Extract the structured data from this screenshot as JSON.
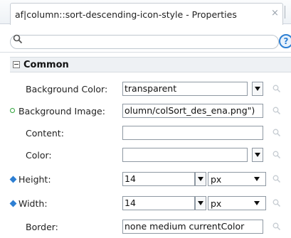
{
  "window": {
    "tab_title": "af|column::sort-descending-icon-style - Properties",
    "close_glyph": "×"
  },
  "search": {
    "placeholder": "",
    "value": "",
    "help_glyph": "?"
  },
  "section": {
    "title": "Common",
    "expanded": true
  },
  "properties": [
    {
      "label": "Background Color:",
      "value": "transparent",
      "control": "combo",
      "marker": "none"
    },
    {
      "label": "Background Image:",
      "value": "olumn/colSort_des_ena.png\")",
      "control": "combo",
      "marker": "set-dot"
    },
    {
      "label": "Content:",
      "value": "",
      "control": "text",
      "marker": "none"
    },
    {
      "label": "Color:",
      "value": "",
      "control": "combo",
      "marker": "none"
    },
    {
      "label": "Height:",
      "value": "14",
      "unit": "px",
      "control": "combo-unit",
      "marker": "diamond"
    },
    {
      "label": "Width:",
      "value": "14",
      "unit": "px",
      "control": "combo-unit",
      "marker": "diamond"
    },
    {
      "label": "Border:",
      "value": "none medium currentColor",
      "control": "text",
      "marker": "none"
    }
  ],
  "colors": {
    "set_marker": "#2fa23a",
    "diamond_marker": "#2d7fd3",
    "help_accent": "#2d7fd3"
  }
}
